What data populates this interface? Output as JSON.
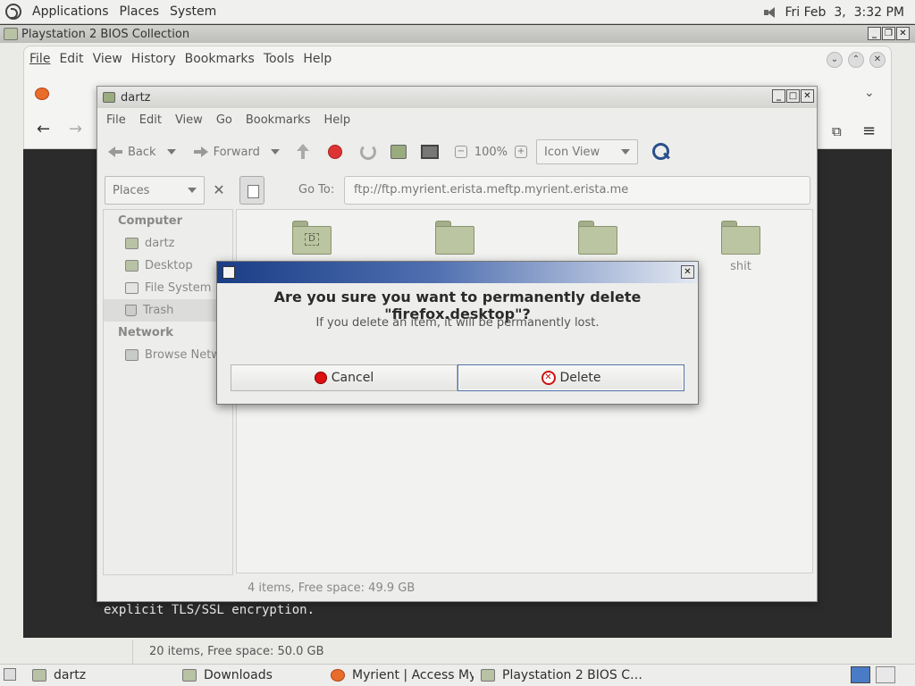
{
  "top_panel": {
    "menus": [
      "Applications",
      "Places",
      "System"
    ],
    "clock": "Fri Feb  3,  3:32 PM"
  },
  "bg_window": {
    "title": "Playstation 2 BIOS Collection",
    "terminal_line": "explicit TLS/SSL encryption.",
    "status": "20 items, Free space: 50.0 GB"
  },
  "firefox": {
    "menus": [
      "File",
      "Edit",
      "View",
      "History",
      "Bookmarks",
      "Tools",
      "Help"
    ]
  },
  "caja": {
    "title": "dartz",
    "menus": [
      "File",
      "Edit",
      "View",
      "Go",
      "Bookmarks",
      "Help"
    ],
    "toolbar": {
      "back": "Back",
      "forward": "Forward",
      "zoom": "100%",
      "view_mode": "Icon View"
    },
    "places_combo": "Places",
    "goto_label": "Go To:",
    "location": "ftp://ftp.myrient.erista.meftp.myrient.erista.me",
    "sidebar": {
      "computer_header": "Computer",
      "computer_items": [
        "dartz",
        "Desktop",
        "File System",
        "Trash"
      ],
      "network_header": "Network",
      "network_items": [
        "Browse Network"
      ]
    },
    "folders": [
      {
        "label": "",
        "badge": "D"
      },
      {
        "label": ""
      },
      {
        "label": ""
      },
      {
        "label": "shit"
      }
    ],
    "status": "4 items, Free space: 49.9 GB"
  },
  "dialog": {
    "primary": "Are you sure you want to permanently delete \"firefox.desktop\"?",
    "secondary": "If you delete an item, it will be permanently lost.",
    "cancel_label": "Cancel",
    "delete_label": "Delete"
  },
  "taskbar": {
    "tasks": [
      "dartz",
      "Downloads",
      "Myrient | Access Myri…",
      "Playstation 2 BIOS C…"
    ]
  }
}
